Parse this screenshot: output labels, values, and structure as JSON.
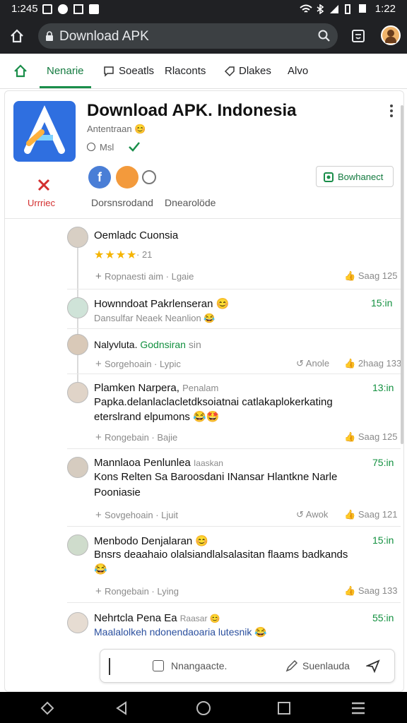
{
  "status_bar": {
    "time": "1:245",
    "clock": "1:22"
  },
  "browser": {
    "url": "Download APK"
  },
  "tabs": [
    {
      "label": "Nenarie",
      "active": true
    },
    {
      "label": "Soeatls",
      "active": false
    },
    {
      "label": "Rlaconts",
      "active": false
    },
    {
      "label": "Dlakes",
      "active": false
    },
    {
      "label": "Alvo",
      "active": false
    }
  ],
  "app": {
    "title": "Download APK. Indonesia",
    "subtitle": "Antentraan 😊",
    "meta": "Msl",
    "remove_label": "Urrriec",
    "links": [
      "Dorsnsrodand",
      "Dnearolöde"
    ],
    "download_button": "Bowhanect",
    "accent_color": "#1a8e4a",
    "icon_color": "#2f6fe0"
  },
  "feed": [
    {
      "name": "Oemladc Cuonsia",
      "rating_stars": 4,
      "rating_text": "· 21",
      "actions_left": "Ropnaesti aim · Lgaie",
      "actions_right": "Saag 125"
    },
    {
      "name": "Hownndoat Pakrlenseran 😊",
      "body": "Dansulfar Neaek Neanlion 😂",
      "time": "15:in"
    },
    {
      "name": "Nalyvluta.",
      "name_extra": "Godnsiran",
      "name_suffix": "sin",
      "actions_left": "Sorgehoain · Lypic",
      "actions_mid": "Anole",
      "actions_right": "2haag 133"
    },
    {
      "name": "Plamken Narpera,",
      "name_extra": "Penalam",
      "body": "Papka.delanlaclacletdksoiatnai catlakaplokerkating",
      "body2": "eterslrand elpumons 😂🤩",
      "time": "13:in",
      "actions_left": "Rongebain · Bajie",
      "actions_right": "Saag 125"
    },
    {
      "name": "Mannlaoa Penlunlea",
      "name_extra": "Iaaskan",
      "body": "Kons Relten Sa Baroosdani INansar Hlantkne Narle",
      "body2": "Pooniasie",
      "time": "75:in",
      "actions_left": "Sovgehoain · Ljuit",
      "actions_mid": "Awok",
      "actions_right": "Saag 121"
    },
    {
      "name": "Menbodo Denjalaran 😊",
      "body": "Bnsrs deaahaio olalsiandlalsalasitan flaams badkands",
      "body2": "😂",
      "time": "15:in",
      "actions_left": "Rongebain · Lying",
      "actions_right": "Saag 133"
    },
    {
      "name": "Nehrtcla Pena Ea",
      "name_extra": "Raasar 😊",
      "body": "Maalalolkeh ndonendaoaria lutesnik 😂",
      "time": "55:in"
    }
  ],
  "compose": {
    "placeholder": "Nnangaacte.",
    "action": "Suenlauda"
  }
}
